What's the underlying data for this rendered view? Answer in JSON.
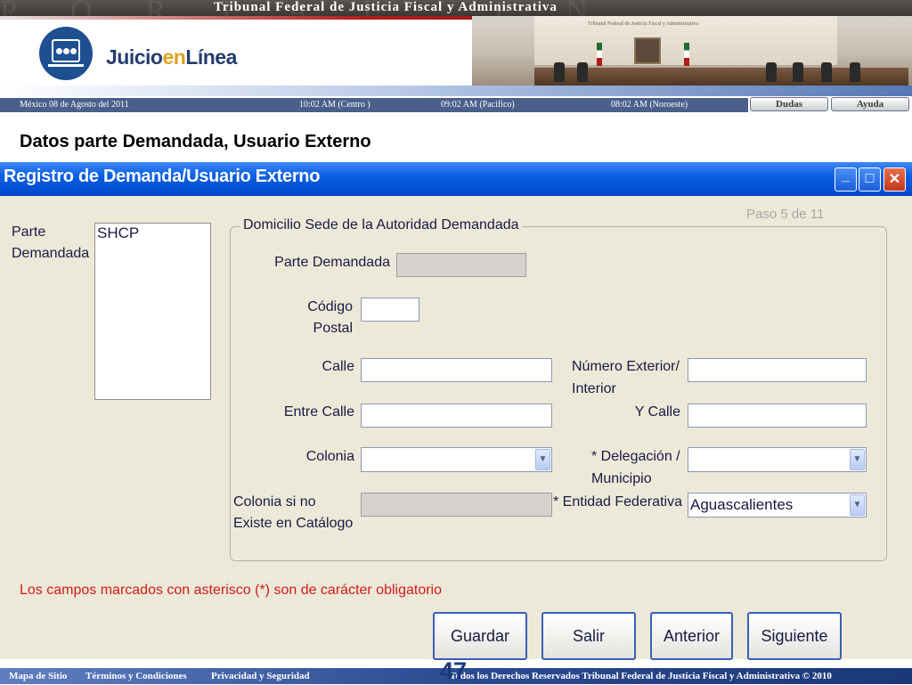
{
  "banner": {
    "watermark": "PORTAL EN LÍNEA",
    "title": "Tribunal Federal de Justicia Fiscal y Administrativa",
    "logo_prefix": "Juicio",
    "logo_en": "en",
    "logo_suffix": "Línea",
    "room_plaque": "Tribunal Federal de Justicia Fiscal y Administrativa"
  },
  "infobar": {
    "date": "México 08 de Agosto del 2011",
    "centro": "10:02  AM (Centro )",
    "pacifico": "09:02 AM  (Pacifico)",
    "noroeste": "08:02 AM (Noroeste)"
  },
  "top_buttons": {
    "dudas": "Dudas",
    "ayuda": "Ayuda"
  },
  "slide_heading": "Datos parte Demandada, Usuario Externo",
  "window": {
    "title": "Registro de Demanda/Usuario Externo",
    "step": "Paso 5 de 11",
    "minimize_label": "_",
    "maximize_label": "□",
    "close_label": "✕"
  },
  "form": {
    "parte_demandada_label_1": "Parte",
    "parte_demandada_label_2": "Demandada",
    "list_items": [
      "SHCP"
    ],
    "group_title": "Domicilio Sede de la Autoridad Demandada",
    "labels": {
      "parte_demandada": "Parte Demandada",
      "codigo_1": "Código",
      "codigo_2": "Postal",
      "calle": "Calle",
      "numero_1": "Número Exterior/",
      "numero_2": "Interior",
      "entre_calle": "Entre Calle",
      "y_calle": "Y Calle",
      "colonia": "Colonia",
      "delegacion_1": "* Delegación /",
      "delegacion_2": "Municipio",
      "colonia_no_1": "Colonia si no",
      "colonia_no_2": "Existe en Catálogo",
      "entidad": "* Entidad Federativa"
    },
    "values": {
      "parte_demandada": "",
      "codigo_postal": "",
      "calle": "",
      "numero": "",
      "entre_calle": "",
      "y_calle": "",
      "colonia": "",
      "delegacion": "",
      "colonia_no_catalogo": "",
      "entidad": "Aguascalientes"
    },
    "warning": "Los campos marcados con asterisco (*) son de carácter obligatorio"
  },
  "buttons": {
    "guardar": "Guardar",
    "salir": "Salir",
    "anterior": "Anterior",
    "siguiente": "Siguiente"
  },
  "footer": {
    "mapa": "Mapa de Sitio",
    "terminos": "Términos y Condiciones",
    "privacidad": "Privacidad y Seguridad",
    "derechos": "Todos los Derechos Reservados   Tribunal Federal de Justicia Fiscal y Administrativa  © 2010"
  },
  "slide_number": "47",
  "colors": {
    "title_bar": "#0a5fe3",
    "window_bg": "#ece9d8",
    "warning": "#d11a1a",
    "footer": "#2b4b92"
  }
}
